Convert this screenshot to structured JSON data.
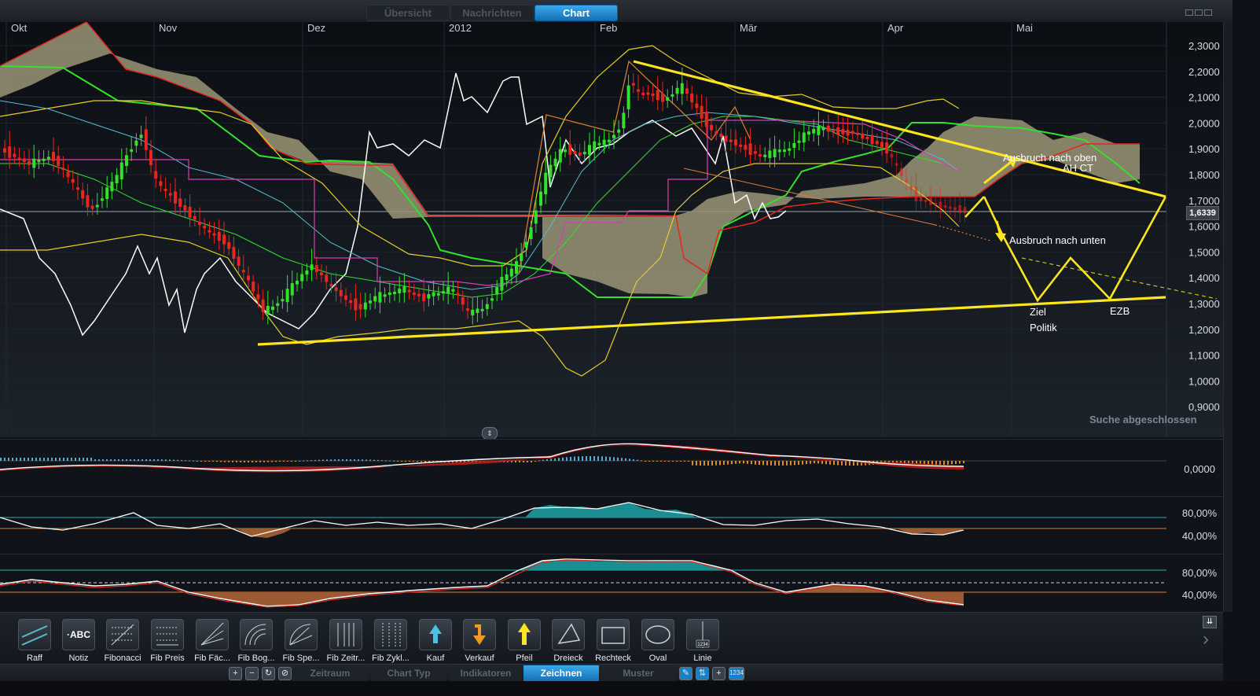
{
  "top_tabs": [
    {
      "label": "Übersicht",
      "active": false
    },
    {
      "label": "Nachrichten",
      "active": false
    },
    {
      "label": "Chart",
      "active": true
    }
  ],
  "chart": {
    "months": [
      "Okt",
      "Nov",
      "Dez",
      "2012",
      "Feb",
      "Mär",
      "Apr",
      "Mai"
    ],
    "y_ticks": [
      "2,3000",
      "2,2000",
      "2,1000",
      "2,0000",
      "1,9000",
      "1,8000",
      "1,7000",
      "1,6000",
      "1,5000",
      "1,4000",
      "1,3000",
      "1,2000",
      "1,1000",
      "1,0000",
      "0,9000"
    ],
    "current_price": "1,6339",
    "annotations": {
      "breakout_up": "Ausbruch nach oben",
      "ah_ct": "AH CT",
      "breakout_down": "Ausbruch nach unten",
      "target": "Ziel",
      "politics": "Politik",
      "ecb": "EZB"
    },
    "status": "Suche abgeschlossen",
    "colors": {
      "trendline": "#ffe51e",
      "cloud": "#9a9577",
      "bull": "#33e02c",
      "bear": "#e8261f"
    }
  },
  "panes": {
    "macd_level": "0,0000",
    "rsi_levels": [
      "80,00%",
      "40,00%"
    ],
    "stoch_levels": [
      "80,00%",
      "40,00%"
    ]
  },
  "toolbar": {
    "tools": [
      {
        "label": "Raff",
        "icon": "raff-channel-icon"
      },
      {
        "label": "Notiz",
        "icon": "note-abc-icon",
        "glyph": "·ABC"
      },
      {
        "label": "Fibonacci",
        "icon": "fibonacci-icon"
      },
      {
        "label": "Fib Preis",
        "icon": "fib-price-icon"
      },
      {
        "label": "Fib Fäc...",
        "icon": "fib-fan-icon"
      },
      {
        "label": "Fib Bog...",
        "icon": "fib-arc-icon"
      },
      {
        "label": "Fib Spe...",
        "icon": "fib-speed-icon"
      },
      {
        "label": "Fib Zeitr...",
        "icon": "fib-time-icon"
      },
      {
        "label": "Fib Zykl...",
        "icon": "fib-cycle-icon"
      },
      {
        "label": "Kauf",
        "icon": "buy-arrow-icon"
      },
      {
        "label": "Verkauf",
        "icon": "sell-arrow-icon"
      },
      {
        "label": "Pfeil",
        "icon": "arrow-icon"
      },
      {
        "label": "Dreieck",
        "icon": "triangle-icon"
      },
      {
        "label": "Rechteck",
        "icon": "rectangle-icon"
      },
      {
        "label": "Oval",
        "icon": "oval-icon"
      },
      {
        "label": "Linie",
        "icon": "line-icon",
        "glyph": "1234"
      }
    ]
  },
  "bottom_tabs": [
    {
      "label": "Zeitraum",
      "active": false
    },
    {
      "label": "Chart Typ",
      "active": false
    },
    {
      "label": "Indikatoren",
      "active": false
    },
    {
      "label": "Zeichnen",
      "active": true
    },
    {
      "label": "Muster",
      "active": false
    }
  ]
}
